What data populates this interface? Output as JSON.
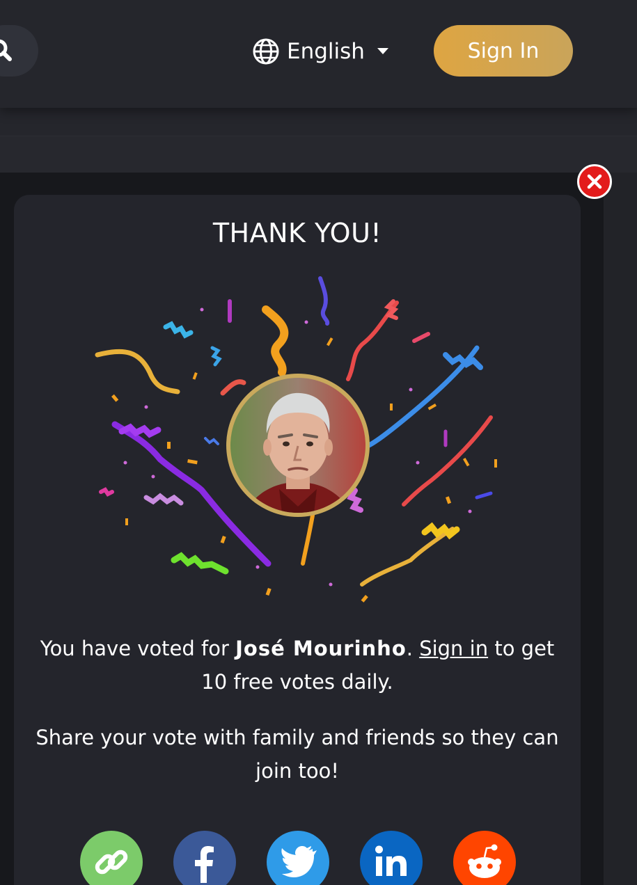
{
  "header": {
    "language": "English",
    "sign_in_label": "Sign In"
  },
  "modal": {
    "title": "THANK YOU!",
    "vote_prefix": "You have voted for ",
    "voted_for": "José Mourinho",
    "vote_dot": ". ",
    "sign_in_link": "Sign in",
    "vote_suffix": " to get 10 free votes daily.",
    "share_text": "Share your vote with family and friends so they can join too!"
  },
  "share": [
    {
      "name": "copy-link",
      "icon": "link-icon",
      "color": "#7ccb6a"
    },
    {
      "name": "facebook",
      "icon": "facebook-icon",
      "color": "#3b5998"
    },
    {
      "name": "twitter",
      "icon": "twitter-icon",
      "color": "#2f9be8"
    },
    {
      "name": "linkedin",
      "icon": "linkedin-icon",
      "color": "#0a66c2"
    },
    {
      "name": "reddit",
      "icon": "reddit-icon",
      "color": "#ff4500"
    }
  ],
  "colors": {
    "accent": "#dea542",
    "close": "#e31b1b",
    "ring": "#c9a95c"
  }
}
